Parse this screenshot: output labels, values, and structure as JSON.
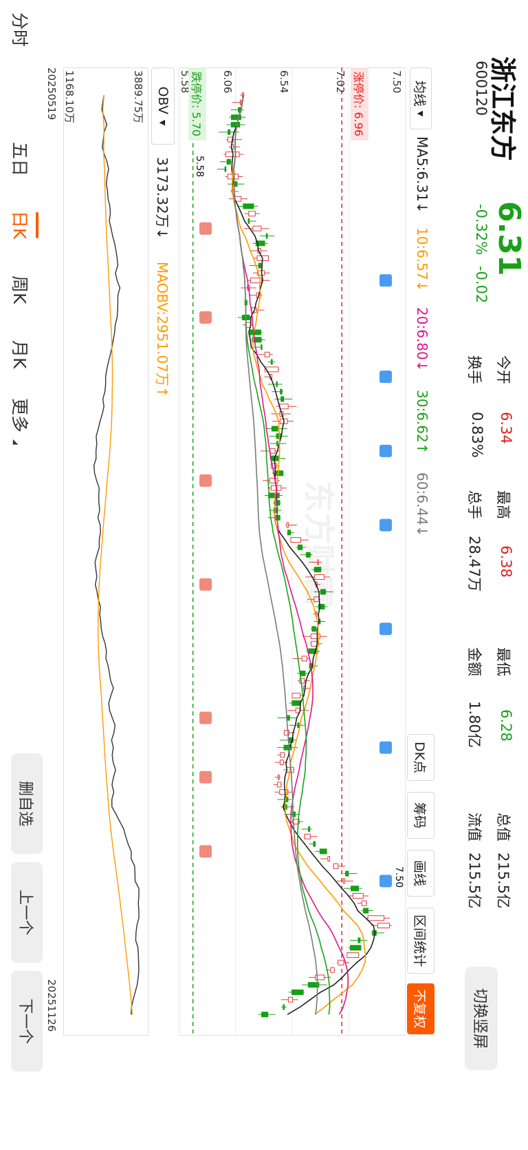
{
  "stock": {
    "name": "浙江东方",
    "code": "600120",
    "price": "6.31",
    "change_pct": "-0.32%",
    "change_abs": "-0.02"
  },
  "quote": {
    "open_label": "今开",
    "open_value": "6.34",
    "high_label": "最高",
    "high_value": "6.38",
    "low_label": "最低",
    "low_value": "6.28",
    "total_mv_label": "总值",
    "total_mv_value": "215.5亿",
    "turnover_label": "换手",
    "turnover_value": "0.83%",
    "volume_label": "总手",
    "volume_value": "28.47万",
    "amount_label": "金额",
    "amount_value": "1.80亿",
    "float_mv_label": "流值",
    "float_mv_value": "215.5亿"
  },
  "header": {
    "switch_screen": "切换竖屏"
  },
  "ma_bar": {
    "selector": "均线",
    "items": [
      {
        "text": "MA5:6.31↓",
        "color": "#222222"
      },
      {
        "text": "10:6.57↓",
        "color": "#ff9a00"
      },
      {
        "text": "20:6.80↓",
        "color": "#e0148c"
      },
      {
        "text": "30:6.62↑",
        "color": "#1aa11a"
      },
      {
        "text": "60:6.44↓",
        "color": "#7a7a7a"
      }
    ]
  },
  "toolbar": {
    "dk": "DK点",
    "chips": "筹码",
    "draw": "画线",
    "interval": "区间统计",
    "adjust": "不复权"
  },
  "chart": {
    "y_labels": [
      "7.50",
      "7.02",
      "6.54",
      "6.06",
      "5.58"
    ],
    "limit_up_label": "涨停价: 6.96",
    "limit_down_label": "跌停价: 5.70",
    "low_marker": "5.58",
    "high_marker": "7.50",
    "watermark": "东方财富"
  },
  "indicator": {
    "selector": "OBV",
    "obv": "3173.32万↓",
    "maobv": "MAOBV:2951.07万↑",
    "top_label": "3889.75万",
    "bottom_label": "1168.10万"
  },
  "dates": {
    "start": "20250519",
    "end": "20251126"
  },
  "bottom_tabs": [
    "分时",
    "五日",
    "日K",
    "周K",
    "月K",
    "更多"
  ],
  "side_buttons": {
    "remove": "删自选",
    "prev": "上一个",
    "next": "下一个"
  },
  "chart_data": {
    "type": "candlestick",
    "x": [
      "20250519",
      "20251126"
    ],
    "y_range": [
      5.58,
      7.5
    ],
    "grid_labels": [
      7.5,
      7.02,
      6.54,
      6.06,
      5.58
    ],
    "limit_up": 6.96,
    "limit_down": 5.7,
    "last_close": 6.31,
    "moving_averages": [
      {
        "name": "MA5",
        "value": 6.31,
        "color": "#222222"
      },
      {
        "name": "MA10",
        "value": 6.57,
        "color": "#ff9a00"
      },
      {
        "name": "MA20",
        "value": 6.8,
        "color": "#e0148c"
      },
      {
        "name": "MA30",
        "value": 6.62,
        "color": "#1aa11a"
      },
      {
        "name": "MA60",
        "value": 6.44,
        "color": "#7a7a7a"
      }
    ],
    "indicator": {
      "name": "OBV",
      "obv": "3173.32万",
      "maobv": "2951.07万",
      "max": "3889.75万",
      "min": "1168.10万"
    }
  }
}
